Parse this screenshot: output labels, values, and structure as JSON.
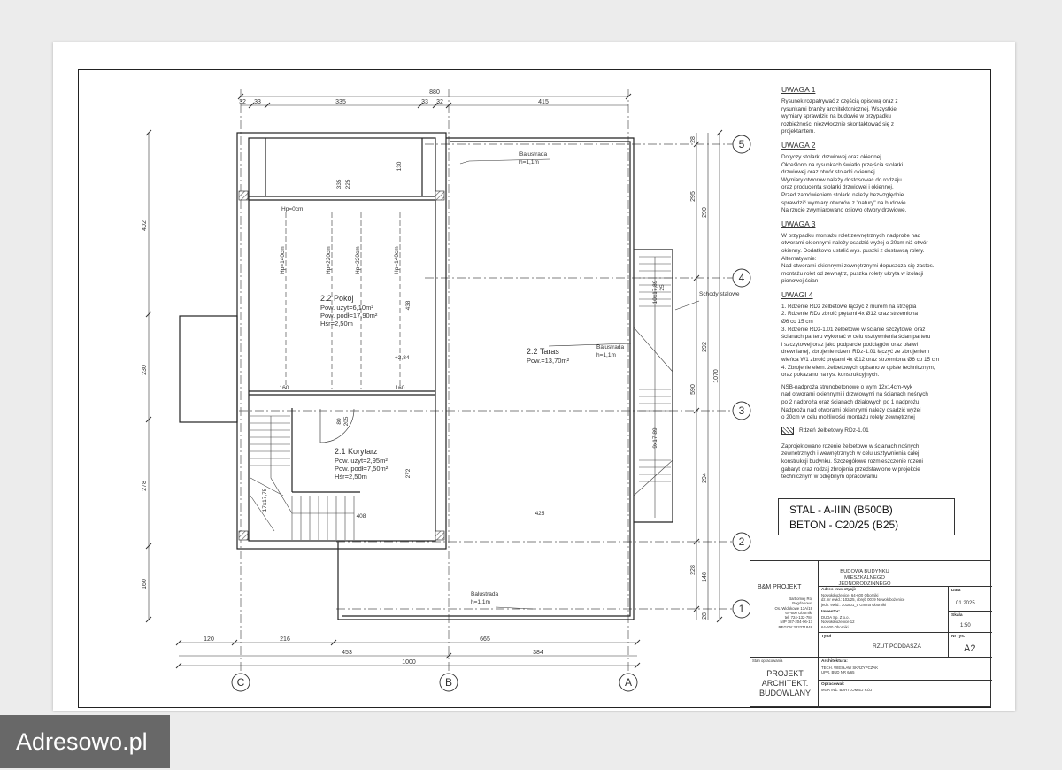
{
  "drawing": {
    "dim_top": {
      "total": "880",
      "s1": "32",
      "s2": "33",
      "s3": "335",
      "s4": "33",
      "s5": "32",
      "s6": "415"
    },
    "dim_left": {
      "d1": "402",
      "d2": "230",
      "d3": "278",
      "d4": "160"
    },
    "dim_bottom": {
      "d1": "120",
      "d2": "216",
      "d3": "665",
      "d4": "453",
      "d5": "384",
      "total": "1000"
    },
    "dim_right": {
      "d1": "28",
      "d2": "295",
      "d3": "290",
      "d4": "292",
      "d5": "590",
      "d6": "1070",
      "d7": "294",
      "d8": "228",
      "d9": "148",
      "d10": "28"
    },
    "axes_right": [
      "5",
      "4",
      "3",
      "2",
      "1"
    ],
    "axes_bottom": [
      "C",
      "B",
      "A"
    ],
    "interior_dims": {
      "v130": "130",
      "v225": "225",
      "v335": "335",
      "v438": "438",
      "v160a": "160",
      "v160b": "160",
      "v80": "80",
      "v205": "205",
      "v272": "272",
      "v425": "425",
      "v408": "408",
      "stair_a": "17x17,75",
      "stair_b": "10x17,89",
      "stair_c": "9x17,89",
      "v25": "25"
    },
    "heights": {
      "hp0": "Hp=0cm",
      "hp140a": "Hp=140cm",
      "hp220a": "Hp=220cm",
      "hp220b": "Hp=220cm",
      "hp140b": "Hp=140cm"
    },
    "rooms": [
      {
        "name": "2.2 Pokój",
        "l1": "Pow. użyt=6,10m²",
        "l2": "Pow. podł=17,90m²",
        "l3": "Hśr=2,50m"
      },
      {
        "name": "2.2 Taras",
        "l1": "Pow.=13,70m²"
      },
      {
        "name": "2.1 Korytarz",
        "l1": "Pow. użyt=2,95m²",
        "l2": "Pow. podł=7,50m²",
        "l3": "Hśr=2,50m"
      }
    ],
    "level": "+2,84",
    "balustrade": {
      "label": "Balustrada",
      "height": "h=1,1m",
      "height_b": "h=1,1m",
      "height_c": "h=1,1m"
    },
    "stairs_label": "Schody stalowe"
  },
  "notes": [
    {
      "title": "UWAGA 1",
      "text": "Rysunek rozpatrywać z częścią opisową oraz z\nrysunkami branży architektonicznej. Wszystkie\nwymiary sprawdzić na budowie w przypadku\nrozbieżności niezwłocznie skontaktować się z\nprojektantem."
    },
    {
      "title": "UWAGA 2",
      "text": "Dotyczy stolarki drzwiowej oraz okiennej.\nOkreślono na rysunkach światło przejścia stolarki\ndrzwiowej oraz otwór stolarki okiennej.\nWymiary otworów należy dostosować do rodzaju\noraz producenta stolarki drzwiowej i okiennej.\nPrzed zamówieniem stolarki należy bezwzględnie\nsprawdzić wymiary otworów z \"natury\" na budowie.\nNa rzucie zwymiarowano osiowo otwory drzwiowe."
    },
    {
      "title": "UWAGA 3",
      "text": "W przypadku montażu rolet zewnętrznych nadproże nad\notworami okiennymi należy osadzić wyżej o 20cm niż otwór\nokienny. Dodatkowo ustalić wys. puszki z dostawcą rolety.\nAlternatywnie:\nNad otworami okiennymi zewnętrznymi dopuszcza się zastos.\nmontażu rolet od zewnątrz, puszka rolety ukryta w izolacji\npionowej ścian"
    },
    {
      "title": "UWAGI 4",
      "text": "1. Rdzenie RDz żelbetowe łączyć z murem na strzępia\n2. Rdzenie RDz zbroić prętami 4x Ø12 oraz strzemiona\nØ6 co 15 cm\n3. Rdzenie RDz-1.01 żelbetowe w ścianie szczytowej oraz\nścianach parteru wykonać w celu usztywnienia ścian parteru\ni szczytowej oraz jako podparcie podciągów oraz płatwi\ndrewnianej, zbrojenie rdzeni RDz-1.01 łączyć ze zbrojeniem\nwieńca W1 zbroić prętami 4x Ø12 oraz strzemiona Ø6 co 15 cm\n4. Zbrojenie elem. żelbetowych opisano w opisie technicznym,\noraz pokazano na rys. konstrukcyjnych."
    }
  ],
  "nsb_note": "NSB-nadproża strunobetonowe o wym 12x14cm-wyk\nnad otworami okiennymi i drzwiowymi na ścianach nośnych\npo 2 nadproża oraz ścianach działowych po 1 nadprożu.\nNadproża nad otworami okiennymi należy osadzić wyżej\no 20cm w celu możliwości montażu rolety zewnętrznej",
  "legend_rdz": "Rdzeń żelbetowy RDz-1.01",
  "design_note": "Zaprojektowano rdzenie żelbetowe w ścianach nośnych\nzewnętrznych i wewnętrznych w celu usztywnienia całej\nkonstrukcji budynku. Szczegółowe rozmieszczenie rdzeni\ngabaryt oraz rodzaj zbrojenia przedstawiono w projekcie\ntechnicznym w odrębnym opracowaniu",
  "materials": {
    "steel": "STAL - A-IIIN (B500B)",
    "concrete": "BETON - C20/25 (B25)"
  },
  "title_block": {
    "company": "B&M PROJEKT",
    "company_info": "Bartłomiej Rój\nBogdanowo\nOs. Widokowe 13A/19\n64-600 Oborniki\ntel. 724-132-784\nNIP 787-204-06-17\nREGON:383371848",
    "project": "BUDOWA BUDYNKU MIESZKALNEGO\nJEDNORODZINNEGO",
    "investor_label": "Adres Inwestycji:",
    "investor_text": "Nowołobożenice, 64-600 Oborniki\ndz. nr ewid.: 102/25, obręb 0019 Nowołobożenice\njedn. ewid.: 301801_5 Gmina Oborniki",
    "owner_label": "Inwestor:",
    "owner_text": "DUDA Sp. Z o.o.\nNowołobożenice 12\n64-600 Oborniki",
    "date_label": "Data",
    "date": "01.2025",
    "scale_label": "Skala",
    "scale": "1:50",
    "title_label": "Tytuł",
    "title": "RZUT PODDASZA",
    "sheet_label": "Nr rys.",
    "sheet": "A2",
    "stage_label": "Stan opracowania",
    "stage": "PROJEKT\nARCHITEKT.\nBUDOWLANY",
    "architect_label": "Architektura:",
    "architect_text": "TECH. WIESŁAW SKRZYPCZAK\nUPR. BUD NR 6/65",
    "drawn_label": "Opracował:",
    "drawn_text": "MGR INŻ. BARTŁOMIEJ RÓJ"
  },
  "watermark": "Adresowo.pl"
}
